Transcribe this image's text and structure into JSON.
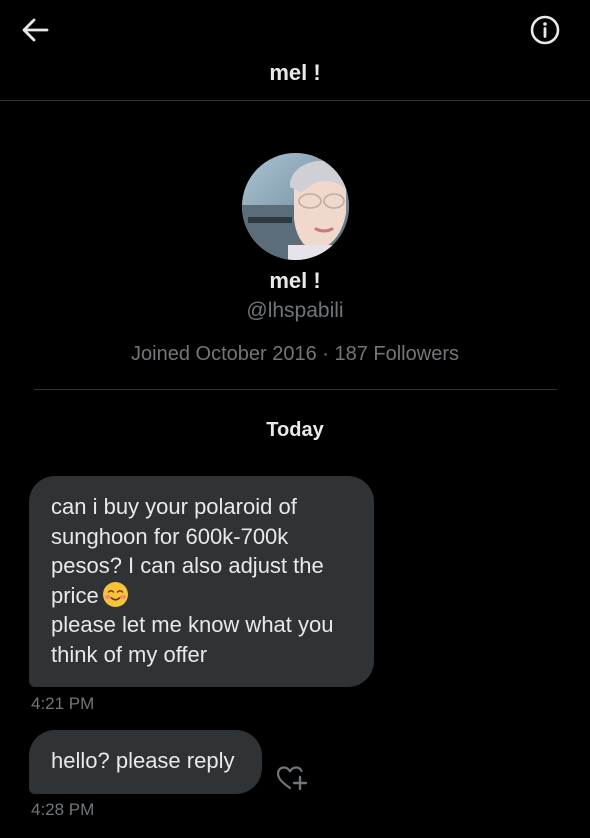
{
  "header": {
    "title": "mel !",
    "back_icon": "arrow-left-icon",
    "info_icon": "info-circle-icon"
  },
  "profile": {
    "name": "mel !",
    "handle": "@lhspabili",
    "meta": "Joined October 2016 · 187 Followers"
  },
  "conversation": {
    "day_label": "Today",
    "messages": [
      {
        "text_before_emoji": "can i buy your polaroid of\nsunghoon for 600k-700k\npesos? I can also adjust the\nprice",
        "emoji": "smiling-face-icon",
        "text_after_emoji": "\nplease let me know what you\nthink of my offer",
        "time": "4:21 PM"
      },
      {
        "text": "hello? please reply",
        "time": "4:28 PM"
      }
    ],
    "reaction_icon": "heart-plus-icon"
  },
  "colors": {
    "background": "#000000",
    "bubble": "#2f3336",
    "primary_text": "#e7e9ea",
    "secondary_text": "#71767b",
    "divider": "#2f3336"
  }
}
